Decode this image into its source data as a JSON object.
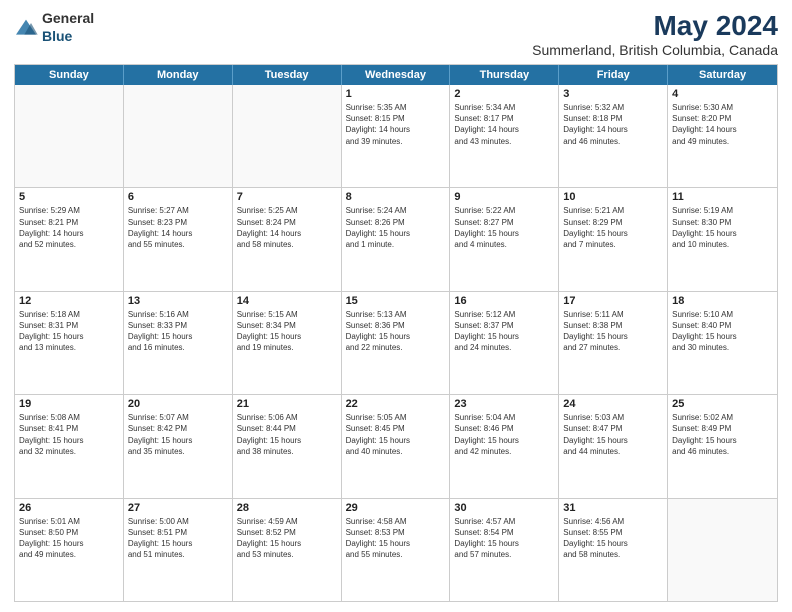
{
  "logo": {
    "general": "General",
    "blue": "Blue"
  },
  "title": "May 2024",
  "subtitle": "Summerland, British Columbia, Canada",
  "header": {
    "days": [
      "Sunday",
      "Monday",
      "Tuesday",
      "Wednesday",
      "Thursday",
      "Friday",
      "Saturday"
    ]
  },
  "weeks": [
    {
      "cells": [
        {
          "day": "",
          "content": ""
        },
        {
          "day": "",
          "content": ""
        },
        {
          "day": "",
          "content": ""
        },
        {
          "day": "1",
          "content": "Sunrise: 5:35 AM\nSunset: 8:15 PM\nDaylight: 14 hours\nand 39 minutes."
        },
        {
          "day": "2",
          "content": "Sunrise: 5:34 AM\nSunset: 8:17 PM\nDaylight: 14 hours\nand 43 minutes."
        },
        {
          "day": "3",
          "content": "Sunrise: 5:32 AM\nSunset: 8:18 PM\nDaylight: 14 hours\nand 46 minutes."
        },
        {
          "day": "4",
          "content": "Sunrise: 5:30 AM\nSunset: 8:20 PM\nDaylight: 14 hours\nand 49 minutes."
        }
      ]
    },
    {
      "cells": [
        {
          "day": "5",
          "content": "Sunrise: 5:29 AM\nSunset: 8:21 PM\nDaylight: 14 hours\nand 52 minutes."
        },
        {
          "day": "6",
          "content": "Sunrise: 5:27 AM\nSunset: 8:23 PM\nDaylight: 14 hours\nand 55 minutes."
        },
        {
          "day": "7",
          "content": "Sunrise: 5:25 AM\nSunset: 8:24 PM\nDaylight: 14 hours\nand 58 minutes."
        },
        {
          "day": "8",
          "content": "Sunrise: 5:24 AM\nSunset: 8:26 PM\nDaylight: 15 hours\nand 1 minute."
        },
        {
          "day": "9",
          "content": "Sunrise: 5:22 AM\nSunset: 8:27 PM\nDaylight: 15 hours\nand 4 minutes."
        },
        {
          "day": "10",
          "content": "Sunrise: 5:21 AM\nSunset: 8:29 PM\nDaylight: 15 hours\nand 7 minutes."
        },
        {
          "day": "11",
          "content": "Sunrise: 5:19 AM\nSunset: 8:30 PM\nDaylight: 15 hours\nand 10 minutes."
        }
      ]
    },
    {
      "cells": [
        {
          "day": "12",
          "content": "Sunrise: 5:18 AM\nSunset: 8:31 PM\nDaylight: 15 hours\nand 13 minutes."
        },
        {
          "day": "13",
          "content": "Sunrise: 5:16 AM\nSunset: 8:33 PM\nDaylight: 15 hours\nand 16 minutes."
        },
        {
          "day": "14",
          "content": "Sunrise: 5:15 AM\nSunset: 8:34 PM\nDaylight: 15 hours\nand 19 minutes."
        },
        {
          "day": "15",
          "content": "Sunrise: 5:13 AM\nSunset: 8:36 PM\nDaylight: 15 hours\nand 22 minutes."
        },
        {
          "day": "16",
          "content": "Sunrise: 5:12 AM\nSunset: 8:37 PM\nDaylight: 15 hours\nand 24 minutes."
        },
        {
          "day": "17",
          "content": "Sunrise: 5:11 AM\nSunset: 8:38 PM\nDaylight: 15 hours\nand 27 minutes."
        },
        {
          "day": "18",
          "content": "Sunrise: 5:10 AM\nSunset: 8:40 PM\nDaylight: 15 hours\nand 30 minutes."
        }
      ]
    },
    {
      "cells": [
        {
          "day": "19",
          "content": "Sunrise: 5:08 AM\nSunset: 8:41 PM\nDaylight: 15 hours\nand 32 minutes."
        },
        {
          "day": "20",
          "content": "Sunrise: 5:07 AM\nSunset: 8:42 PM\nDaylight: 15 hours\nand 35 minutes."
        },
        {
          "day": "21",
          "content": "Sunrise: 5:06 AM\nSunset: 8:44 PM\nDaylight: 15 hours\nand 38 minutes."
        },
        {
          "day": "22",
          "content": "Sunrise: 5:05 AM\nSunset: 8:45 PM\nDaylight: 15 hours\nand 40 minutes."
        },
        {
          "day": "23",
          "content": "Sunrise: 5:04 AM\nSunset: 8:46 PM\nDaylight: 15 hours\nand 42 minutes."
        },
        {
          "day": "24",
          "content": "Sunrise: 5:03 AM\nSunset: 8:47 PM\nDaylight: 15 hours\nand 44 minutes."
        },
        {
          "day": "25",
          "content": "Sunrise: 5:02 AM\nSunset: 8:49 PM\nDaylight: 15 hours\nand 46 minutes."
        }
      ]
    },
    {
      "cells": [
        {
          "day": "26",
          "content": "Sunrise: 5:01 AM\nSunset: 8:50 PM\nDaylight: 15 hours\nand 49 minutes."
        },
        {
          "day": "27",
          "content": "Sunrise: 5:00 AM\nSunset: 8:51 PM\nDaylight: 15 hours\nand 51 minutes."
        },
        {
          "day": "28",
          "content": "Sunrise: 4:59 AM\nSunset: 8:52 PM\nDaylight: 15 hours\nand 53 minutes."
        },
        {
          "day": "29",
          "content": "Sunrise: 4:58 AM\nSunset: 8:53 PM\nDaylight: 15 hours\nand 55 minutes."
        },
        {
          "day": "30",
          "content": "Sunrise: 4:57 AM\nSunset: 8:54 PM\nDaylight: 15 hours\nand 57 minutes."
        },
        {
          "day": "31",
          "content": "Sunrise: 4:56 AM\nSunset: 8:55 PM\nDaylight: 15 hours\nand 58 minutes."
        },
        {
          "day": "",
          "content": ""
        }
      ]
    }
  ]
}
